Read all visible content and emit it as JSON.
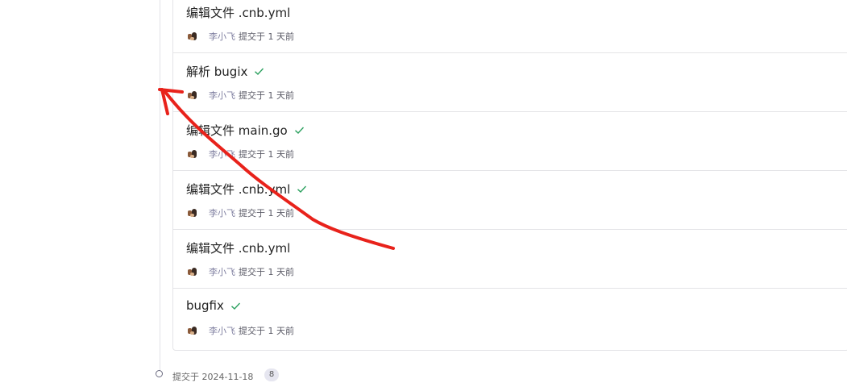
{
  "commits": [
    {
      "title": "编辑文件 .cnb.yml",
      "author": "李小飞",
      "time": "提交于 1 天前",
      "verified": false
    },
    {
      "title": "解析 bugix",
      "author": "李小飞",
      "time": "提交于 1 天前",
      "verified": true
    },
    {
      "title": "编辑文件 main.go",
      "author": "李小飞",
      "time": "提交于 1 天前",
      "verified": true
    },
    {
      "title": "编辑文件 .cnb.yml",
      "author": "李小飞",
      "time": "提交于 1 天前",
      "verified": true
    },
    {
      "title": "编辑文件 .cnb.yml",
      "author": "李小飞",
      "time": "提交于 1 天前",
      "verified": false
    },
    {
      "title": "bugfix",
      "author": "李小飞",
      "time": "提交于 1 天前",
      "verified": true
    }
  ],
  "footer": {
    "text": "提交于 2024-11-18",
    "count": "8"
  },
  "colors": {
    "check": "#2da160",
    "annotation": "#e8221b",
    "author": "#7f7fa0"
  },
  "icons": {
    "verified": "check-icon",
    "annotation": "red-arrow-annotation"
  }
}
